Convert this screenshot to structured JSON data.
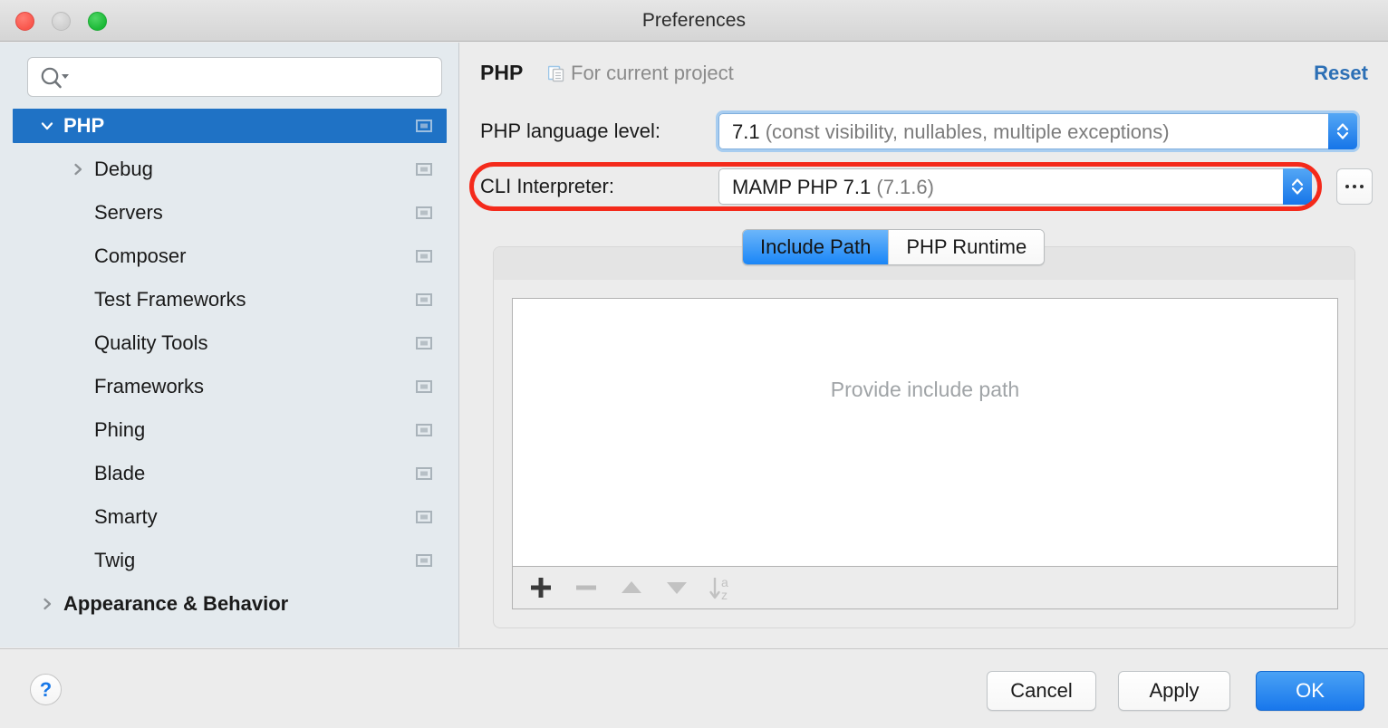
{
  "window": {
    "title": "Preferences",
    "traffic_lights": [
      "close",
      "minimize",
      "zoom"
    ]
  },
  "sidebar": {
    "search": {
      "value": "",
      "placeholder": ""
    },
    "items": [
      {
        "label": "PHP",
        "level": 0,
        "selected": true,
        "bold": true,
        "disclosure": "expanded",
        "module_icon": true
      },
      {
        "label": "Debug",
        "level": 1,
        "selected": false,
        "bold": false,
        "disclosure": "collapsed",
        "module_icon": true
      },
      {
        "label": "Servers",
        "level": 1,
        "selected": false,
        "bold": false,
        "disclosure": "none",
        "module_icon": true
      },
      {
        "label": "Composer",
        "level": 1,
        "selected": false,
        "bold": false,
        "disclosure": "none",
        "module_icon": true
      },
      {
        "label": "Test Frameworks",
        "level": 1,
        "selected": false,
        "bold": false,
        "disclosure": "none",
        "module_icon": true
      },
      {
        "label": "Quality Tools",
        "level": 1,
        "selected": false,
        "bold": false,
        "disclosure": "none",
        "module_icon": true
      },
      {
        "label": "Frameworks",
        "level": 1,
        "selected": false,
        "bold": false,
        "disclosure": "none",
        "module_icon": true
      },
      {
        "label": "Phing",
        "level": 1,
        "selected": false,
        "bold": false,
        "disclosure": "none",
        "module_icon": true
      },
      {
        "label": "Blade",
        "level": 1,
        "selected": false,
        "bold": false,
        "disclosure": "none",
        "module_icon": true
      },
      {
        "label": "Smarty",
        "level": 1,
        "selected": false,
        "bold": false,
        "disclosure": "none",
        "module_icon": true
      },
      {
        "label": "Twig",
        "level": 1,
        "selected": false,
        "bold": false,
        "disclosure": "none",
        "module_icon": true
      },
      {
        "label": "Appearance & Behavior",
        "level": 0,
        "selected": false,
        "bold": true,
        "disclosure": "collapsed",
        "module_icon": false
      }
    ]
  },
  "page": {
    "title": "PHP",
    "scope_label": "For current project",
    "scope_icon": "module-copy-icon",
    "reset_label": "Reset",
    "fields": [
      {
        "label": "PHP language level:",
        "value_main": "7.1",
        "value_detail": "(const visibility, nullables, multiple exceptions)",
        "focused": true
      },
      {
        "label": "CLI Interpreter:",
        "value_main": "MAMP PHP 7.1",
        "value_detail": "(7.1.6)",
        "focused": false,
        "has_browse_button": true,
        "browse_label": "..."
      }
    ],
    "tabs": [
      {
        "label": "Include Path",
        "active": true
      },
      {
        "label": "PHP Runtime",
        "active": false
      }
    ],
    "list": {
      "placeholder": "Provide include path",
      "rows": [],
      "toolbar": [
        {
          "name": "add",
          "glyph": "+",
          "enabled": true
        },
        {
          "name": "remove",
          "glyph": "−",
          "enabled": false
        },
        {
          "name": "move-up",
          "glyph": "▲",
          "enabled": false
        },
        {
          "name": "move-down",
          "glyph": "▼",
          "enabled": false
        },
        {
          "name": "sort-a-z",
          "glyph": "↓az",
          "enabled": false
        }
      ]
    }
  },
  "annotation": {
    "highlight_target": "CLI Interpreter:",
    "color": "#f42a1b",
    "shape": "rounded-rectangle"
  },
  "footer": {
    "help_label": "?",
    "buttons": [
      {
        "label": "Cancel",
        "primary": false
      },
      {
        "label": "Apply",
        "primary": false
      },
      {
        "label": "OK",
        "primary": true
      }
    ]
  },
  "colors": {
    "accent_blue": "#1f72c5",
    "selection_blue": "#1f72c5",
    "sidebar_bg": "#e4eaee",
    "panel_bg": "#ececec",
    "link_blue": "#2c6fb5",
    "highlight_red": "#f42a1b"
  }
}
